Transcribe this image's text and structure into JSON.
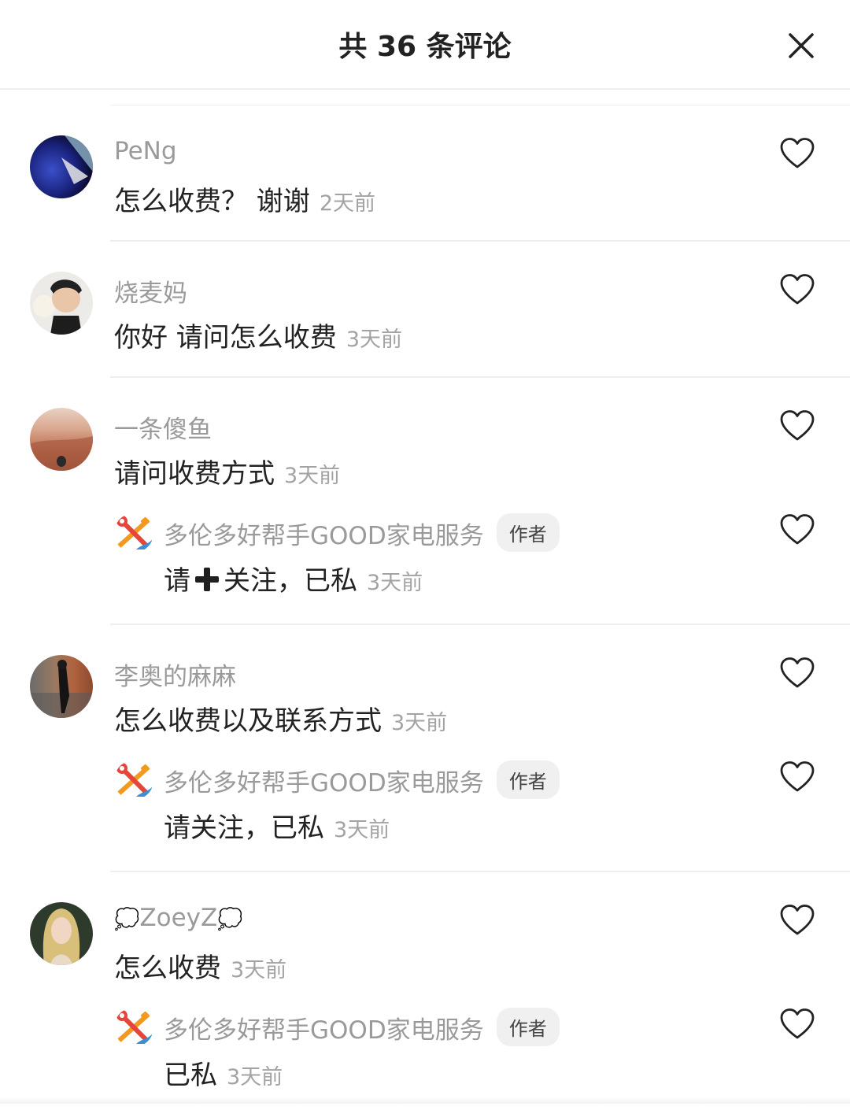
{
  "header": {
    "title": "共 36 条评论",
    "close_icon": "close-icon"
  },
  "threads": [
    {
      "comment": {
        "author": "PeNg",
        "text": "怎么收费？  谢谢",
        "time": "2天前",
        "avatar_icon": "avatar-photo"
      }
    },
    {
      "comment": {
        "author": "烧麦妈",
        "text": "你好 请问怎么收费",
        "time": "3天前",
        "avatar_icon": "avatar-photo"
      }
    },
    {
      "comment": {
        "author": "一条傻鱼",
        "text": "请问收费方式",
        "time": "3天前",
        "avatar_icon": "avatar-photo"
      },
      "reply": {
        "author": "多伦多好帮手GOOD家电服务",
        "badge": "作者",
        "text_before": "请",
        "plus_icon": "plus-emoji-icon",
        "text_after": "关注，已私",
        "time": "3天前"
      }
    },
    {
      "comment": {
        "author": "李奥的麻麻",
        "text": "怎么收费以及联系方式",
        "time": "3天前",
        "avatar_icon": "avatar-photo"
      },
      "reply": {
        "author": "多伦多好帮手GOOD家电服务",
        "badge": "作者",
        "text": "请关注，已私",
        "time": "3天前"
      }
    },
    {
      "comment": {
        "author": "ZoeyZ",
        "author_prefix": "💭",
        "author_suffix": "💭",
        "text": "怎么收费",
        "time": "3天前",
        "avatar_icon": "avatar-photo"
      },
      "reply": {
        "author": "多伦多好帮手GOOD家电服务",
        "badge": "作者",
        "text": "已私",
        "time": "3天前"
      }
    }
  ],
  "colors": {
    "text_primary": "#222222",
    "text_secondary": "#9a9a9a",
    "divider": "#eeeeee",
    "badge_bg": "#f0f0f0",
    "tool_orange": "#f29a1f",
    "tool_red": "#e5453a"
  },
  "icons": {
    "like": "heart-outline-icon",
    "reply_avatar": "tools-logo-icon"
  }
}
